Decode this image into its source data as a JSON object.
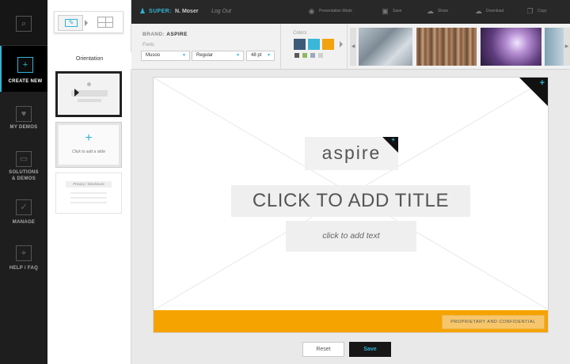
{
  "nav": {
    "search_icon": "search-icon",
    "items": [
      {
        "label_line1": "CREATE NEW",
        "label_line2": "",
        "icon": "plus-icon",
        "active": true
      },
      {
        "label_line1": "MY DEMOS",
        "label_line2": "",
        "icon": "heart-icon",
        "active": false
      },
      {
        "label_line1": "SOLUTIONS",
        "label_line2": "& DEMOS",
        "icon": "monitor-icon",
        "active": false
      },
      {
        "label_line1": "MANAGE",
        "label_line2": "",
        "icon": "check-icon",
        "active": false
      },
      {
        "label_line1": "HELP / FAQ",
        "label_line2": "",
        "icon": "lifebuoy-icon",
        "active": false
      }
    ]
  },
  "panel": {
    "orientation_label": "Orientation",
    "add_slide_text": "Click to add a slide",
    "disclosure_tag": "Privacy / Disclosure"
  },
  "topbar": {
    "user_prefix": "SUPER:",
    "user_name": "N. Moser",
    "logout": "Log Out",
    "actions": [
      {
        "label": "Presentation Mode",
        "icon": "eye-icon"
      },
      {
        "label": "Save",
        "icon": "save-icon"
      },
      {
        "label": "Share",
        "icon": "cloud-upload-icon"
      },
      {
        "label": "Download",
        "icon": "cloud-download-icon"
      },
      {
        "label": "Copy",
        "icon": "copy-icon"
      }
    ]
  },
  "toolbar": {
    "brand_prefix": "BRAND:",
    "brand_name": "ASPIRE",
    "fonts_label": "Fonts",
    "font_family": "Musoo",
    "font_weight": "Regular",
    "font_size": "48 pt",
    "colors_label": "Colors",
    "swatches": [
      "#3d5a78",
      "#3ab7d8",
      "#f2a30f"
    ],
    "small_swatches": [
      "#5a5a5a",
      "#8fb860",
      "#9aaabb",
      "#cfcfcf"
    ]
  },
  "slide": {
    "logo_text": "aspire",
    "title": "CLICK TO ADD TITLE",
    "subtitle": "click to add text",
    "footer_label": "PROPRIETARY AND CONFIDENTIAL",
    "footer_color": "#f5a300"
  },
  "buttons": {
    "reset": "Reset",
    "save": "Save"
  },
  "colors": {
    "accent": "#2fb4d5",
    "nav_bg": "#1e1e1e"
  }
}
